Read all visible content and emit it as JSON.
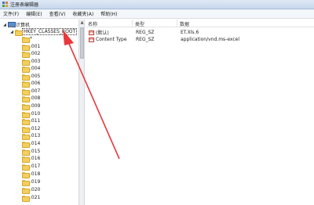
{
  "window": {
    "title": "注册表编辑器"
  },
  "menu": {
    "items": [
      "文件(F)",
      "编辑(E)",
      "查看(V)",
      "收藏夹(A)",
      "帮助(H)"
    ]
  },
  "tree": {
    "root": "计算机",
    "hkey": "HKEY_CLASSES_ROOT",
    "items": [
      "*",
      ".001",
      ".002",
      ".003",
      ".004",
      ".005",
      ".006",
      ".007",
      ".008",
      ".009",
      ".010",
      ".011",
      ".012",
      ".013",
      ".014",
      ".015",
      ".016",
      ".017",
      ".018",
      ".019",
      ".020",
      ".021"
    ]
  },
  "values": {
    "columns": [
      "名称",
      "类型",
      "数据"
    ],
    "rows": [
      {
        "name": "(默认)",
        "type": "REG_SZ",
        "data": "ET.Xls.6"
      },
      {
        "name": "Content Type",
        "type": "REG_SZ",
        "data": "application/vnd.ms-excel"
      }
    ]
  },
  "colors": {
    "annotation_arrow": "#e8383d",
    "folder": "#f3cf5e"
  }
}
